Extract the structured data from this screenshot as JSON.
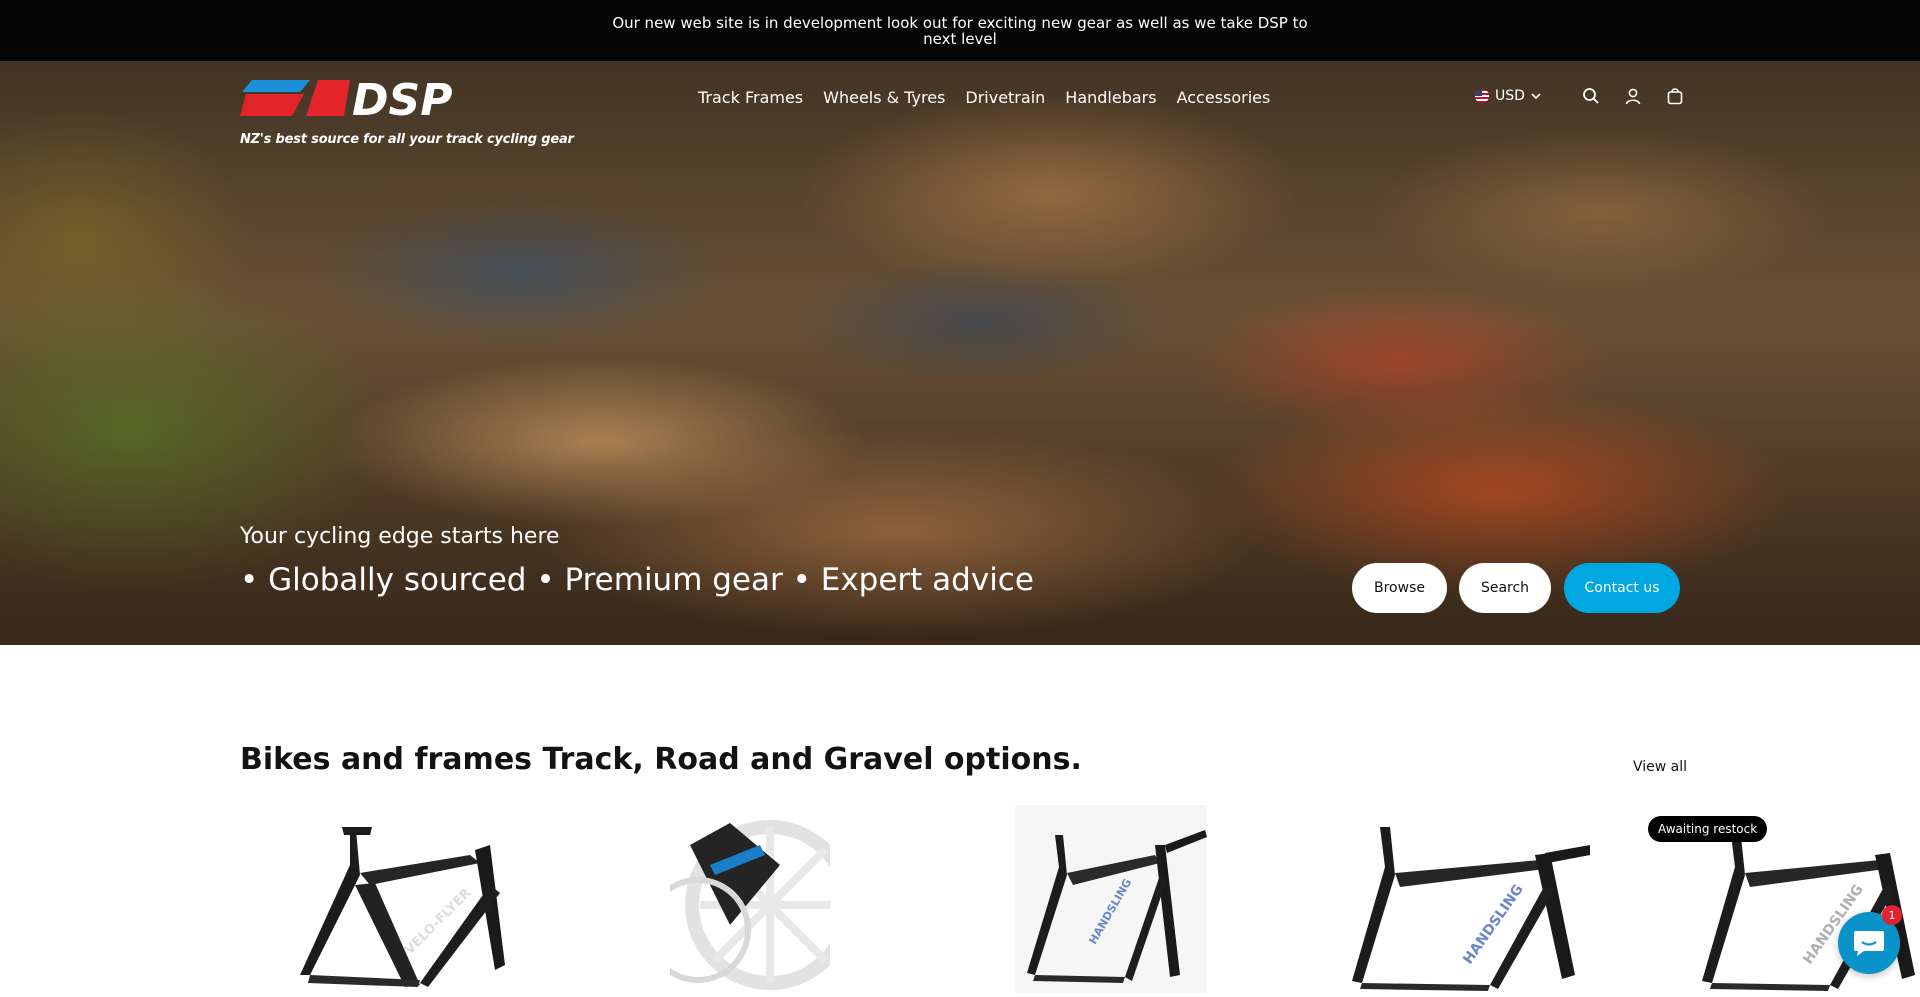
{
  "announcement": {
    "text": "Our new web site is in development look out for exciting new gear as well as we take DSP to next level"
  },
  "brand": {
    "logo_text": "DSP",
    "tagline": "NZ's best source for all your track cycling gear"
  },
  "nav": {
    "items": [
      {
        "label": "Track Frames"
      },
      {
        "label": "Wheels & Tyres"
      },
      {
        "label": "Drivetrain"
      },
      {
        "label": "Handlebars"
      },
      {
        "label": "Accessories"
      }
    ]
  },
  "header_utils": {
    "currency": "USD",
    "icons": [
      "us-flag-icon",
      "chevron-down-icon",
      "search-icon",
      "account-icon",
      "cart-icon"
    ]
  },
  "hero": {
    "subheading": "Your cycling edge starts here",
    "heading": "• Globally sourced • Premium gear • Expert advice",
    "buttons": {
      "browse": "Browse",
      "search": "Search",
      "contact": "Contact us"
    }
  },
  "collection": {
    "title": "Bikes and frames Track, Road and Gravel options.",
    "view_all": "View all",
    "badge": "Awaiting restock",
    "products": [
      {
        "frame_text": "VELO-FLYER"
      },
      {
        "frame_text": ""
      },
      {
        "frame_text": "HANDSLING"
      },
      {
        "frame_text": "HANDSLING"
      },
      {
        "frame_text": "HANDSLING"
      }
    ]
  },
  "chat": {
    "count": "1"
  },
  "colors": {
    "accent": "#00a7e1",
    "announcement_bg": "#050505",
    "logo_red": "#e3242b",
    "logo_blue": "#1c8fd9"
  }
}
